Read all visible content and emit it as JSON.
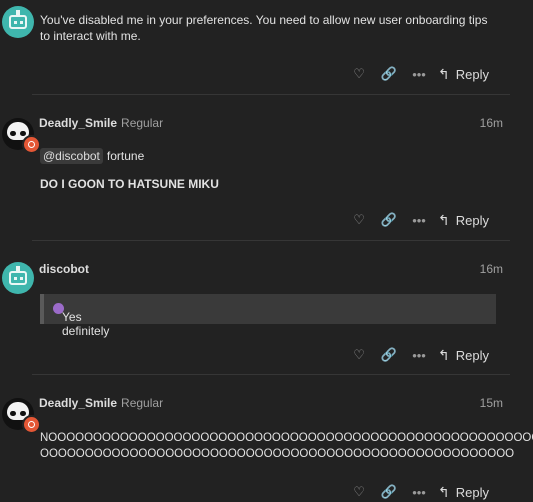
{
  "posts": [
    {
      "author": "",
      "body": "You've disabled me in your preferences. You need to allow new user onboarding tips to interact with me.",
      "reply_label": "Reply"
    },
    {
      "author": "Deadly_Smile",
      "title": "Regular",
      "time": "16m",
      "mention": "@discobot",
      "mention_text": "fortune",
      "body": "DO I GOON TO HATSUNE MIKU",
      "reply_label": "Reply"
    },
    {
      "author": "discobot",
      "time": "16m",
      "quote": "Yes definitely",
      "reply_label": "Reply"
    },
    {
      "author": "Deadly_Smile",
      "title": "Regular",
      "time": "15m",
      "body_line1": "NOOOOOOOOOOOOOOOOOOOOOOOOOOOOOOOOOOOOOOOOOOOOOOOOOOOOOOOOO",
      "body_line2": "OOOOOOOOOOOOOOOOOOOOOOOOOOOOOOOOOOOOOOOOOOOOOOOOOOOOO",
      "reply_label": "Reply"
    }
  ],
  "icons": {
    "like": "heart-icon",
    "link": "link-icon",
    "more": "ellipsis-icon",
    "reply": "reply-arrow-icon"
  },
  "colors": {
    "background": "#222222",
    "badge": "#e45735",
    "robot": "#3fb6ad"
  }
}
